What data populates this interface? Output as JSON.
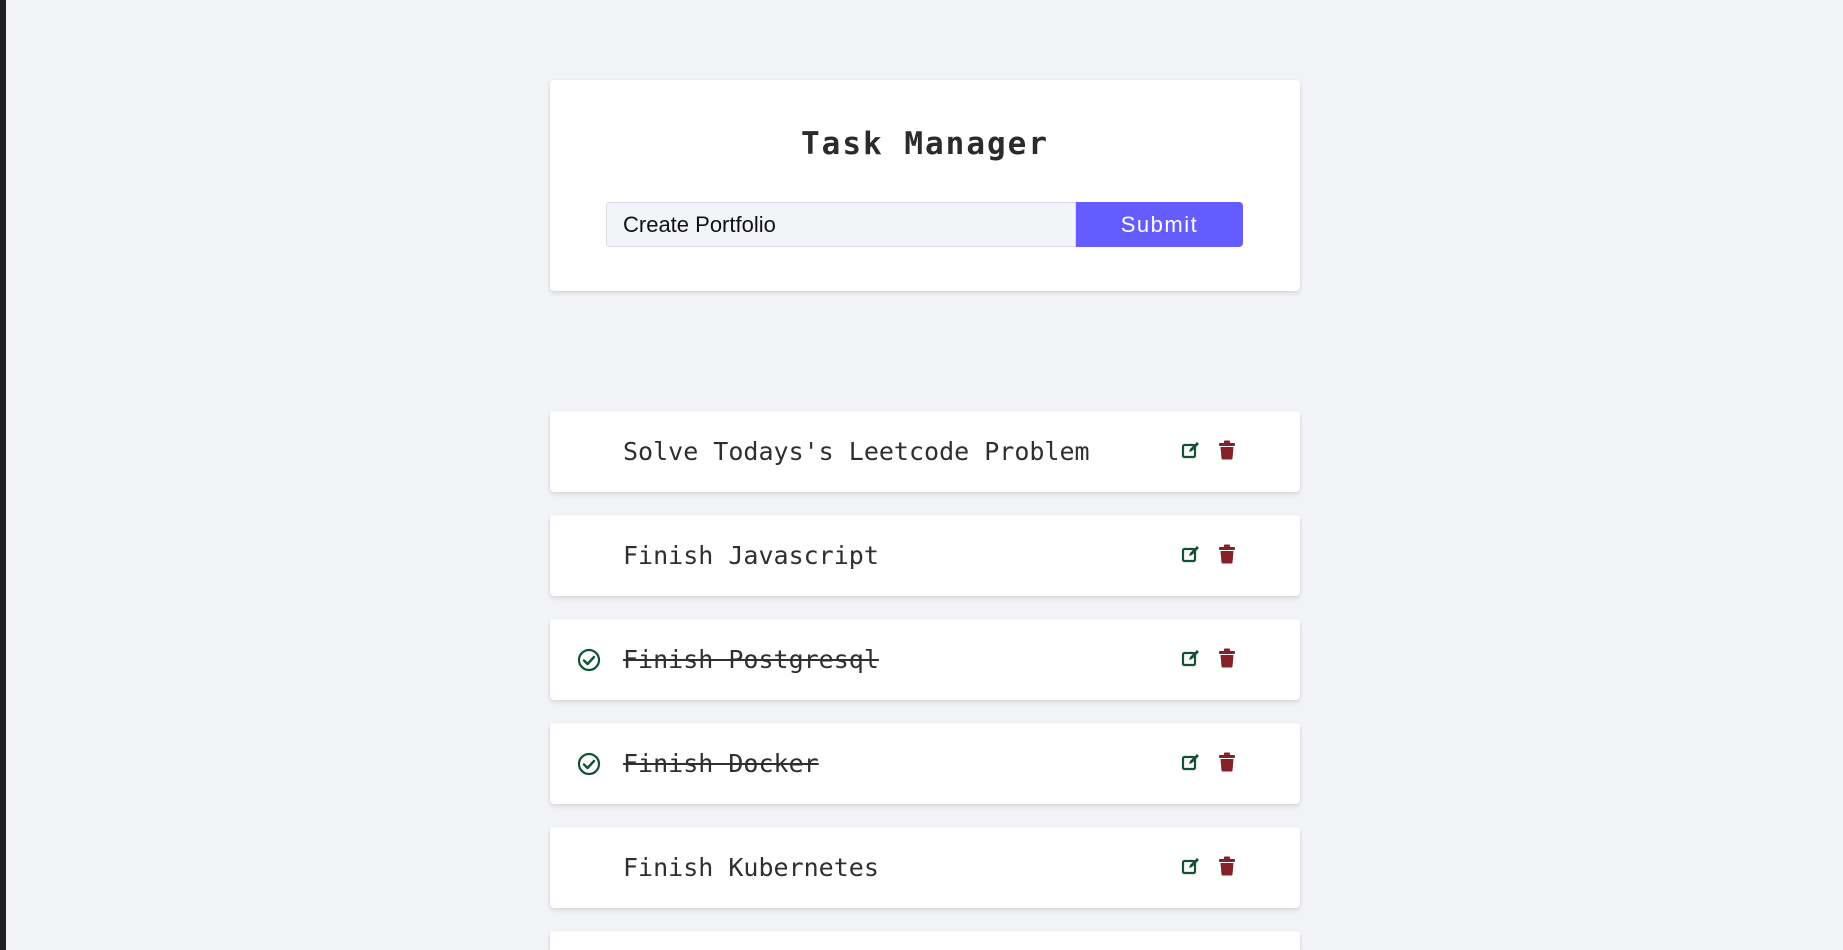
{
  "app": {
    "title": "Task Manager"
  },
  "form": {
    "input_value": "Create Portfolio",
    "input_placeholder": "",
    "submit_label": "Submit"
  },
  "colors": {
    "background": "#f2f3f6",
    "card": "#ffffff",
    "accent": "#645cff",
    "edit_icon": "#0f5132",
    "delete_icon": "#842029",
    "check_icon": "#0f5132"
  },
  "tasks": [
    {
      "text": "Solve Todays's Leetcode Problem",
      "completed": false
    },
    {
      "text": "Finish Javascript",
      "completed": false
    },
    {
      "text": "Finish Postgresql",
      "completed": true
    },
    {
      "text": "Finish Docker",
      "completed": true
    },
    {
      "text": "Finish Kubernetes",
      "completed": false
    }
  ],
  "icons": {
    "edit": "edit-icon",
    "delete": "trash-icon",
    "done": "check-circle-icon"
  }
}
